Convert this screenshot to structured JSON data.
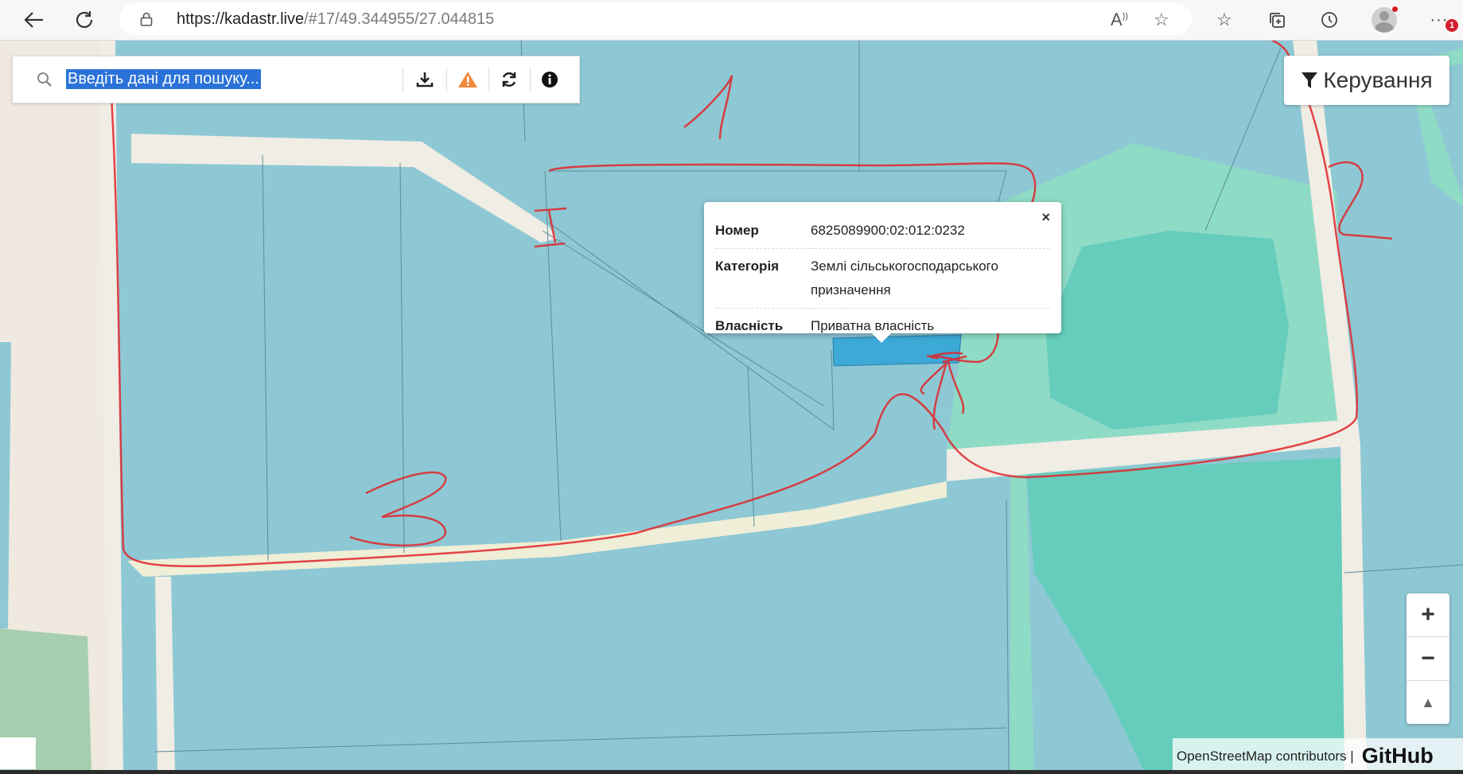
{
  "browser": {
    "url_host": "https://kadastr.live",
    "url_path": "/#17/49.344955/27.044815"
  },
  "search": {
    "placeholder": "Введіть дані для пошуку..."
  },
  "control_button": {
    "label": "Керування"
  },
  "popup": {
    "rows": [
      {
        "key": "Номер",
        "value": "6825089900:02:012:0232"
      },
      {
        "key": "Категорія",
        "value": "Землі сільськогосподарського призначення"
      },
      {
        "key": "Власність",
        "value": "Приватна власність"
      }
    ],
    "close": "×"
  },
  "zoom": {
    "in": "+",
    "out": "−",
    "reset": "▲"
  },
  "attribution": {
    "osm": "OpenStreetMap contributors |",
    "github": "GitHub"
  },
  "badge": "1",
  "colors": {
    "parcel_blue": "#8ec8d4",
    "parcel_green": "#8edbc6",
    "forest_green": "#66cdbd",
    "road": "#f0ede5",
    "selected_parcel": "#3ca9d7",
    "annotation_red": "#e0262c"
  },
  "annotations": {
    "label_1": "1",
    "label_2": "2",
    "label_3": "3"
  }
}
